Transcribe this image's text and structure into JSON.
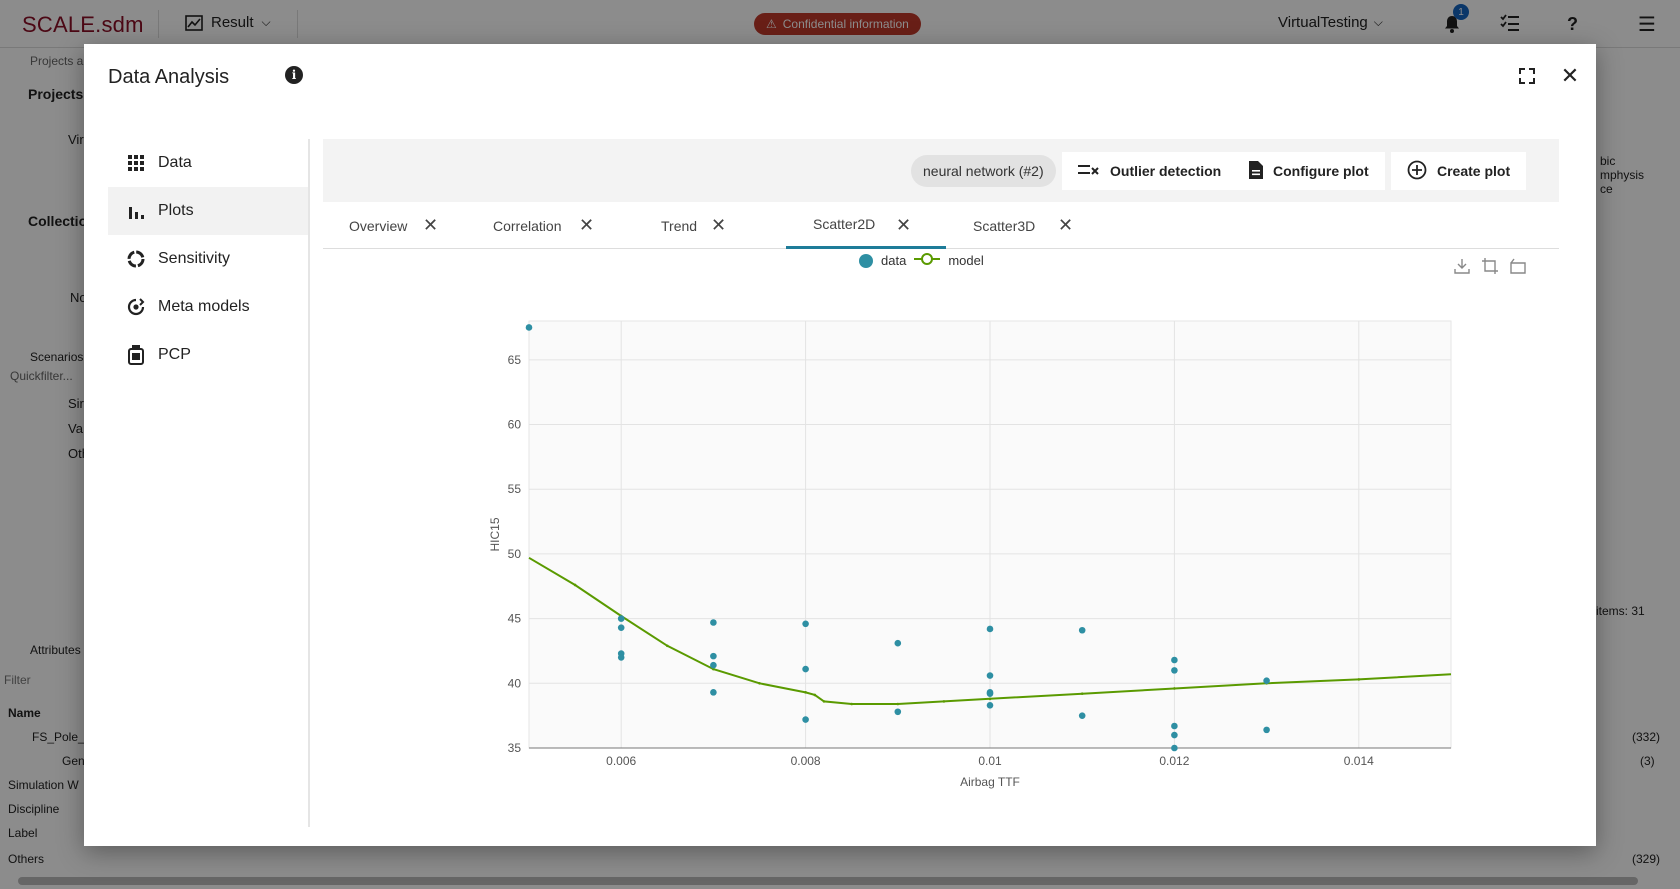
{
  "topbar": {
    "logo": "SCALE.sdm",
    "result_label": "Result",
    "confidential": "Confidential information",
    "workspace": "VirtualTesting",
    "notification_count": "1"
  },
  "background": {
    "left_items": [
      "Projects a",
      "Projects",
      "Vir",
      "Collectio",
      "No",
      "Scenarios",
      "Quickfilter...",
      "Sir",
      "Va",
      "Oth",
      "Attributes",
      "Filter",
      "Name",
      "FS_Pole_",
      "Gen",
      "Simulation W",
      "Discipline",
      "Label",
      "Others"
    ],
    "right_items": [
      "bic",
      "mphysis",
      "ce",
      "items: 31",
      "(332)",
      "(3)",
      "(329)"
    ]
  },
  "modal": {
    "title": "Data Analysis",
    "sidebar": [
      {
        "label": "Data",
        "icon": "grid-icon"
      },
      {
        "label": "Plots",
        "icon": "bar-chart-icon"
      },
      {
        "label": "Sensitivity",
        "icon": "donut-icon"
      },
      {
        "label": "Meta models",
        "icon": "meta-model-icon"
      },
      {
        "label": "PCP",
        "icon": "pcp-icon"
      }
    ],
    "toolbar": {
      "chip": "neural network (#2)",
      "outlier": "Outlier detection",
      "configure": "Configure plot",
      "create": "Create plot"
    },
    "tabs": [
      "Overview",
      "Correlation",
      "Trend",
      "Scatter2D",
      "Scatter3D"
    ],
    "active_tab": "Scatter2D"
  },
  "chart_data": {
    "type": "scatter",
    "xlabel": "Airbag TTF",
    "ylabel": "HIC15",
    "xlim": [
      0.005,
      0.015
    ],
    "ylim": [
      35,
      68
    ],
    "xticks": [
      "0.006",
      "0.008",
      "0.01",
      "0.012",
      "0.014"
    ],
    "yticks": [
      "35",
      "40",
      "45",
      "50",
      "55",
      "60",
      "65"
    ],
    "grid": true,
    "legend_position": "top-center",
    "series": [
      {
        "name": "data",
        "color": "#2e8fa3",
        "points": [
          [
            0.005,
            67.5
          ],
          [
            0.006,
            45.0
          ],
          [
            0.006,
            44.3
          ],
          [
            0.006,
            42.3
          ],
          [
            0.006,
            42.0
          ],
          [
            0.007,
            44.7
          ],
          [
            0.007,
            42.1
          ],
          [
            0.007,
            41.4
          ],
          [
            0.007,
            39.3
          ],
          [
            0.008,
            44.6
          ],
          [
            0.008,
            41.1
          ],
          [
            0.008,
            37.2
          ],
          [
            0.009,
            43.1
          ],
          [
            0.009,
            37.8
          ],
          [
            0.01,
            44.2
          ],
          [
            0.01,
            40.6
          ],
          [
            0.01,
            39.3
          ],
          [
            0.01,
            39.2
          ],
          [
            0.01,
            38.3
          ],
          [
            0.011,
            44.1
          ],
          [
            0.011,
            37.5
          ],
          [
            0.012,
            41.8
          ],
          [
            0.012,
            41.0
          ],
          [
            0.012,
            36.7
          ],
          [
            0.012,
            36.0
          ],
          [
            0.012,
            35.0
          ],
          [
            0.013,
            40.2
          ],
          [
            0.013,
            36.4
          ]
        ]
      },
      {
        "name": "model",
        "color": "#5a9a00",
        "points": [
          [
            0.005,
            49.7
          ],
          [
            0.0055,
            47.6
          ],
          [
            0.006,
            45.2
          ],
          [
            0.0065,
            42.9
          ],
          [
            0.007,
            41.1
          ],
          [
            0.0075,
            40.0
          ],
          [
            0.008,
            39.3
          ],
          [
            0.0081,
            39.1
          ],
          [
            0.0082,
            38.6
          ],
          [
            0.0085,
            38.4
          ],
          [
            0.009,
            38.4
          ],
          [
            0.0095,
            38.6
          ],
          [
            0.01,
            38.8
          ],
          [
            0.011,
            39.2
          ],
          [
            0.012,
            39.6
          ],
          [
            0.013,
            40.0
          ],
          [
            0.014,
            40.3
          ],
          [
            0.015,
            40.7
          ]
        ]
      }
    ]
  }
}
